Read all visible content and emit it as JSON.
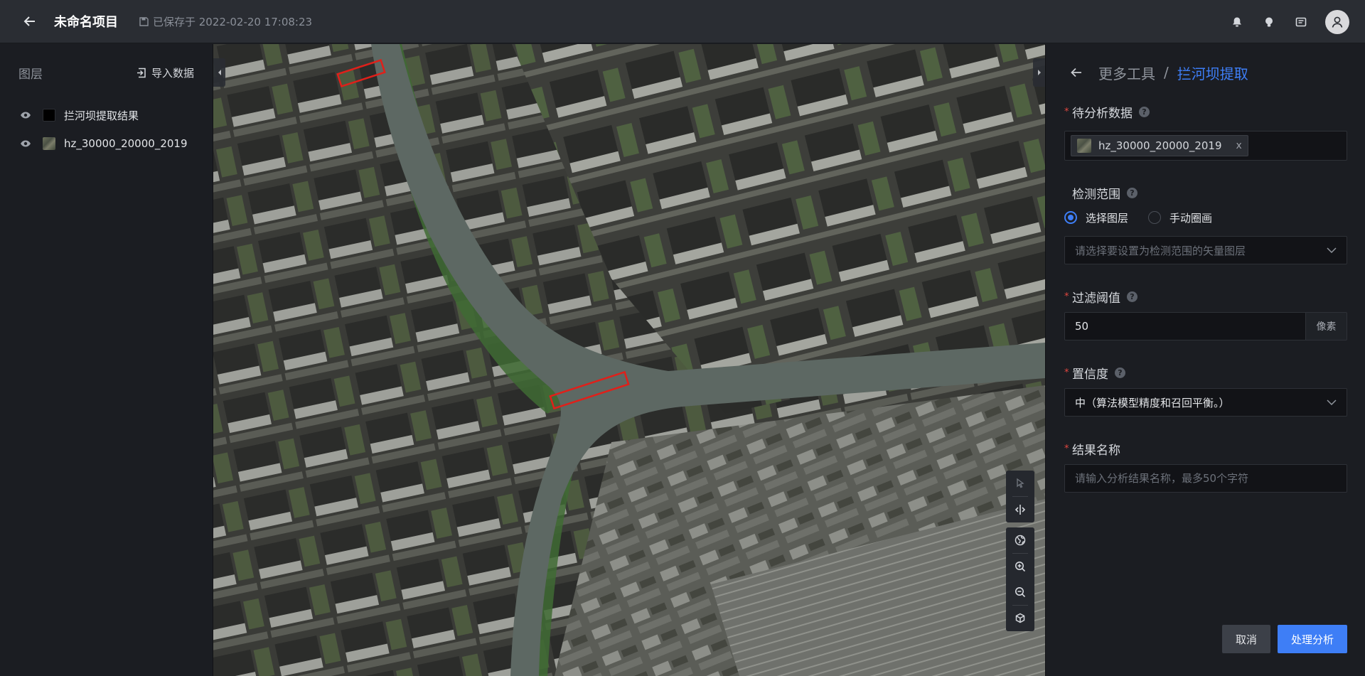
{
  "header": {
    "project_title": "未命名项目",
    "save_status": "已保存于 2022-02-20 17:08:23"
  },
  "left_panel": {
    "title": "图层",
    "import_label": "导入数据",
    "layers": [
      {
        "name": "拦河坝提取结果",
        "swatch": "#000000"
      },
      {
        "name": "hz_30000_20000_2019",
        "swatch": "imagery"
      }
    ]
  },
  "right_panel": {
    "breadcrumb": {
      "parent": "更多工具",
      "separator": "/",
      "current": "拦河坝提取"
    },
    "fields": {
      "data": {
        "label": "待分析数据",
        "tag": "hz_30000_20000_2019",
        "tag_close": "x"
      },
      "range": {
        "label": "检测范围",
        "options": [
          "选择图层",
          "手动圈画"
        ],
        "selected": "选择图层",
        "placeholder": "请选择要设置为检测范围的矢量图层"
      },
      "threshold": {
        "label": "过滤阈值",
        "value": "50",
        "unit": "像素"
      },
      "confidence": {
        "label": "置信度",
        "value": "中（算法模型精度和召回平衡。）"
      },
      "result_name": {
        "label": "结果名称",
        "placeholder": "请输入分析结果名称，最多50个字符"
      }
    },
    "buttons": {
      "cancel": "取消",
      "submit": "处理分析"
    }
  },
  "colors": {
    "accent": "#3e7ef6",
    "required": "#e2463f",
    "detection_box": "#e0201a"
  }
}
